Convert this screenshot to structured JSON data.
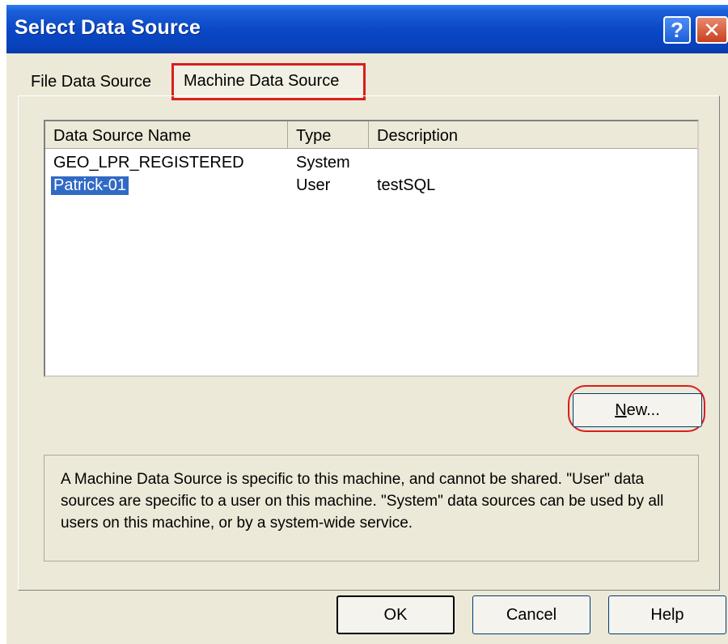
{
  "window": {
    "title": "Select Data Source",
    "help_button": "?",
    "close_button": "✕"
  },
  "tabs": [
    {
      "label": "File Data Source"
    },
    {
      "label": "Machine Data Source"
    }
  ],
  "list": {
    "columns": [
      "Data Source Name",
      "Type",
      "Description"
    ],
    "rows": [
      {
        "name": "GEO_LPR_REGISTERED",
        "type": "System",
        "description": ""
      },
      {
        "name": "Patrick-01",
        "type": "User",
        "description": "testSQL"
      }
    ]
  },
  "new_button": {
    "mnemonic": "N",
    "rest": "ew..."
  },
  "description": "A Machine Data Source is specific to this machine, and cannot be shared. \"User\" data sources are specific to a user on this machine.  \"System\" data sources can be used by all users on this machine, or by a system-wide service.",
  "footer": {
    "ok": "OK",
    "cancel": "Cancel",
    "help": "Help"
  },
  "colors": {
    "titlebar": "#0a48c7",
    "selection": "#316ac5",
    "annotation": "#d81e1e"
  }
}
